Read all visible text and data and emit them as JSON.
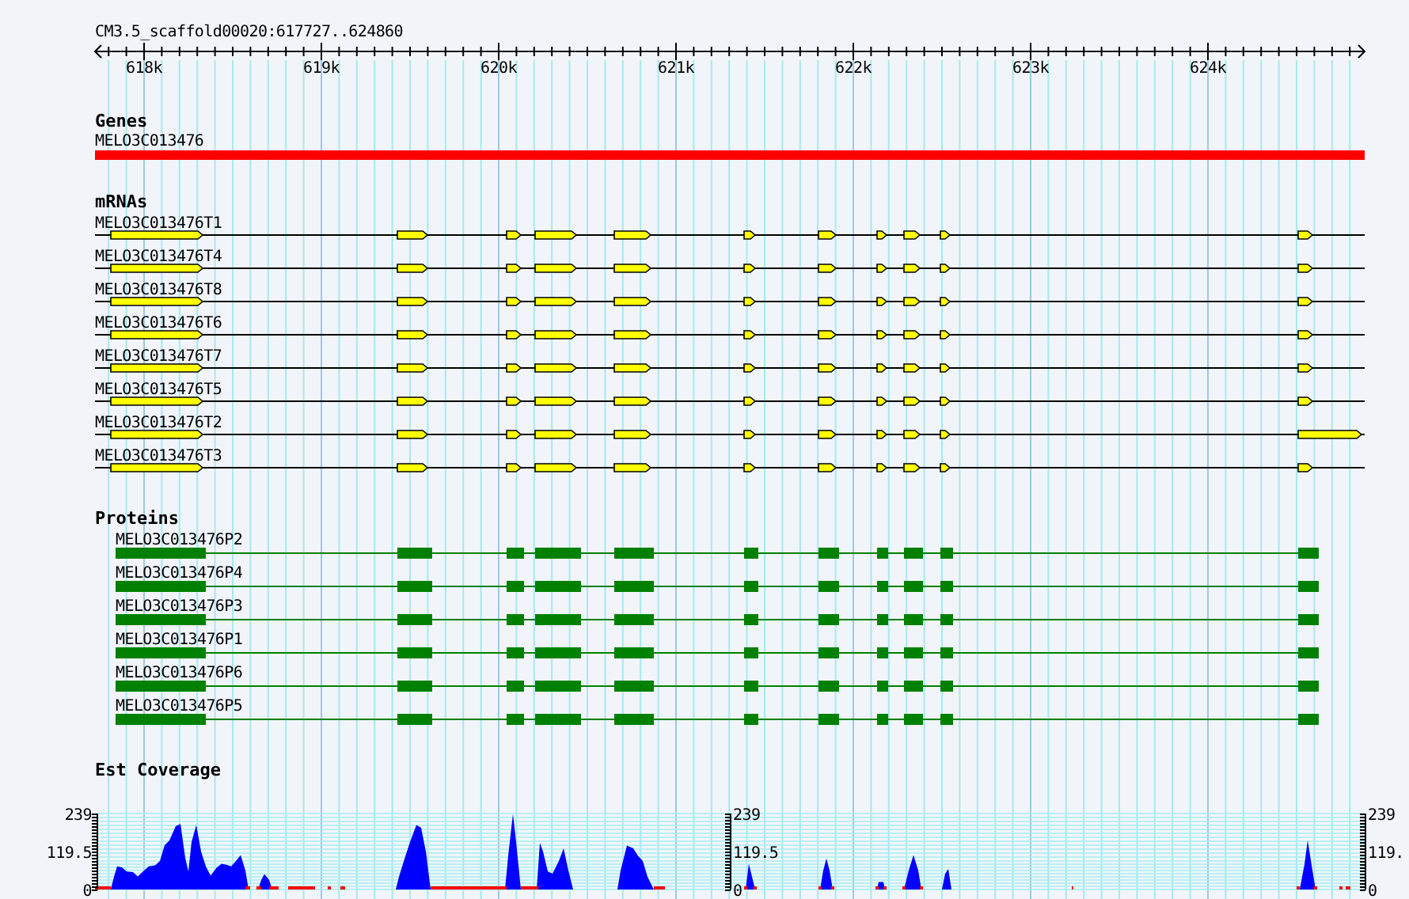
{
  "ruler": {
    "label": "CM3.5_scaffold00020:617727..624860",
    "ticks": [
      "618k",
      "619k",
      "620k",
      "621k",
      "622k",
      "623k",
      "624k"
    ]
  },
  "genes": {
    "title": "Genes",
    "items": [
      {
        "name": "MELO3C013476"
      }
    ]
  },
  "mrnas": {
    "title": "mRNAs",
    "items": [
      {
        "name": "MELO3C013476T1",
        "extended_3prime": false
      },
      {
        "name": "MELO3C013476T4",
        "extended_3prime": false
      },
      {
        "name": "MELO3C013476T8",
        "extended_3prime": false
      },
      {
        "name": "MELO3C013476T6",
        "extended_3prime": false
      },
      {
        "name": "MELO3C013476T7",
        "extended_3prime": false
      },
      {
        "name": "MELO3C013476T5",
        "extended_3prime": false
      },
      {
        "name": "MELO3C013476T2",
        "extended_3prime": true
      },
      {
        "name": "MELO3C013476T3",
        "extended_3prime": false
      }
    ]
  },
  "proteins": {
    "title": "Proteins",
    "items": [
      {
        "name": "MELO3C013476P2"
      },
      {
        "name": "MELO3C013476P4"
      },
      {
        "name": "MELO3C013476P3"
      },
      {
        "name": "MELO3C013476P1"
      },
      {
        "name": "MELO3C013476P6"
      },
      {
        "name": "MELO3C013476P5"
      }
    ]
  },
  "coverage": {
    "title": "Est Coverage",
    "scales": [
      {
        "ticks": [
          "239",
          "119.5",
          "0"
        ]
      },
      {
        "ticks": [
          "239",
          "119.5",
          "0"
        ]
      },
      {
        "ticks": [
          "239",
          "119.",
          "0"
        ]
      }
    ]
  }
}
